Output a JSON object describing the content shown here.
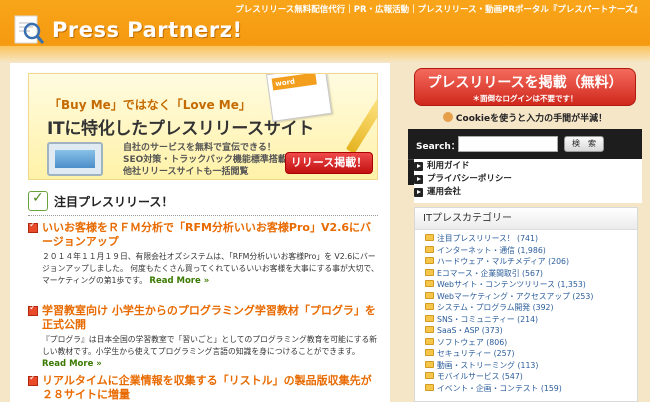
{
  "header": {
    "logo_text": "Press Partnerz!",
    "tagline": "プレスリリース無料配信代行｜PR・広報活動｜プレスリリース・動画PRポータル『プレスパートナーズ』"
  },
  "banner": {
    "line1": "「Buy Me」ではなく「Love Me」",
    "line2": "ITに特化したプレスリリースサイト",
    "features": [
      "自社のサービスを無料で宣伝できる！",
      "SEO対策・トラックバック機能標準搭載",
      "他社リリースサイトも一括閲覧"
    ],
    "note_label": "word",
    "button": "リリース掲載！"
  },
  "news": {
    "heading": "注目プレスリリース！",
    "articles": [
      {
        "title": "いいお客様をＲＦＭ分析で「RFM分析いいお客様Pro」V2.6にバージョンアップ",
        "body": "２０１４年１１月１９日、有限会社オズシステムは、「RFM分析いいお客様Pro」を V2.6にバージョンアップしました。 何度もたくさん買ってくれているいいお客様を大事にする事が大切で、マーケティングの第1歩です。",
        "more": "Read More »"
      },
      {
        "title": "学習教室向け 小学生からのプログラミング学習教材「プログラ」を正式公開",
        "body": "『プログラ』は日本全国の学習教室で「習いごと」としてのプログラミング教育を可能にする新しい教材です。小学生から使えてプログラミング言語の知識を身につけることができます。",
        "more": "Read More »"
      },
      {
        "title": "リアルタイムに企業情報を収集する「リストル」の製品版収集先が２８サイトに増量",
        "body": "",
        "more": ""
      }
    ]
  },
  "sidebar": {
    "post_button": "プレスリリースを掲載（無料）",
    "post_button_sub": "＊面倒なログインは不要です！",
    "cookie_note": "Cookieを使うと入力の手間が半減！",
    "search_label": "Search：",
    "search_placeholder": "",
    "search_button": "検　索",
    "links": [
      "利用ガイド",
      "プライバシーポリシー",
      "運用会社"
    ],
    "category_title": "ITプレスカテゴリー",
    "categories": [
      "注目プレスリリース！ (741)",
      "インターネット・通信 (1,986)",
      "ハードウェア・マルチメディア (206)",
      "Eコマース・企業間取引 (567)",
      "Webサイト・コンテンツリリース (1,353)",
      "Webマーケティング・アクセスアップ (253)",
      "システム・プログラム開発 (392)",
      "SNS・コミュニティー (214)",
      "SaaS・ASP (373)",
      "ソフトウェア (806)",
      "セキュリティー (257)",
      "動画・ストリーミング (113)",
      "モバイルサービス (547)",
      "イベント・企画・コンテスト (159)"
    ]
  },
  "colors": {
    "header_orange": "#f59a10",
    "accent_red": "#d0281c",
    "title_orange": "#e86a00",
    "link_blue": "#2a5c9a",
    "read_more_green": "#3a7a00"
  }
}
